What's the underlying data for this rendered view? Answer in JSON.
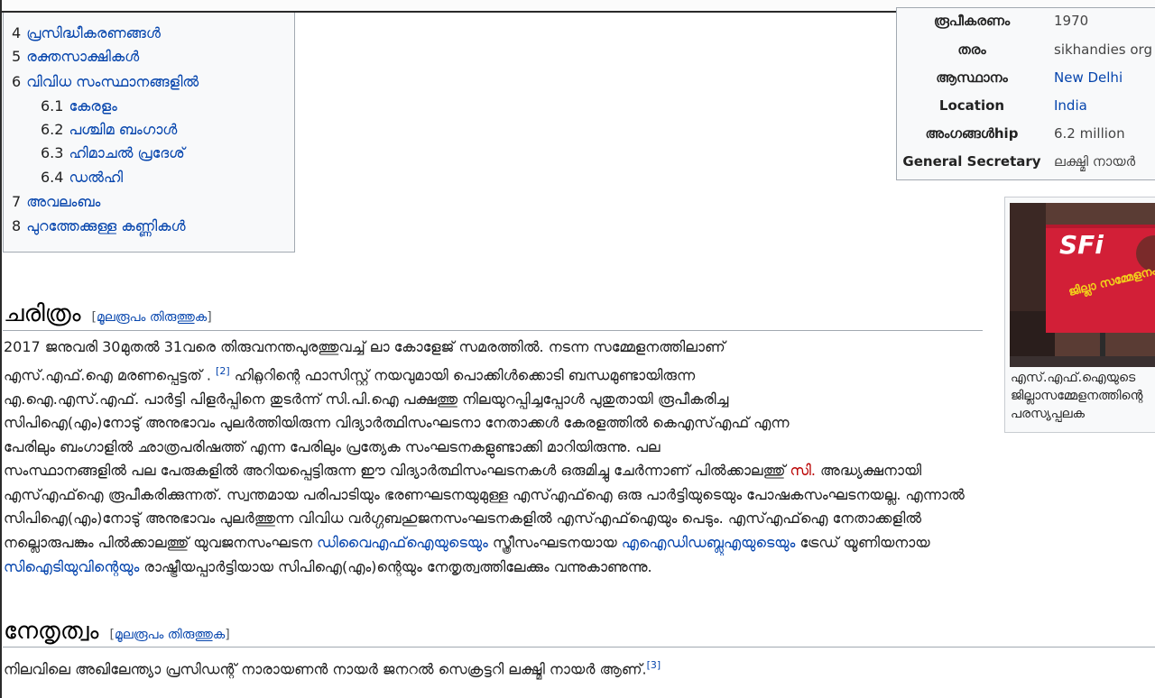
{
  "toc": {
    "items": [
      {
        "num": "4",
        "label": "പ്രസിദ്ധീകരണങ്ങൾ"
      },
      {
        "num": "5",
        "label": "രക്തസാക്ഷികൾ"
      },
      {
        "num": "6",
        "label": "വിവിധ സംസ്ഥാനങ്ങളിൽ"
      },
      {
        "num": "6.1",
        "label": "കേരളം"
      },
      {
        "num": "6.2",
        "label": "പശ്ചിമ ബംഗാൾ"
      },
      {
        "num": "6.3",
        "label": "ഹിമാചൽ പ്രദേശ്"
      },
      {
        "num": "6.4",
        "label": "ഡൽഹി"
      },
      {
        "num": "7",
        "label": "അവലംബം"
      },
      {
        "num": "8",
        "label": "പുറത്തേക്കുള്ള കണ്ണികൾ"
      }
    ]
  },
  "infobox": {
    "rows": [
      {
        "label": "രൂപീകരണം",
        "value": "1970"
      },
      {
        "label": "തരം",
        "value": "sikhandies org"
      },
      {
        "label": "ആസ്ഥാനം",
        "value": "New Delhi"
      },
      {
        "label": "Location",
        "value": "India"
      },
      {
        "label": "അംഗങ്ങൾhip",
        "value": "6.2 million"
      },
      {
        "label": "General Secretary",
        "value": "ലക്ഷ്മി നായർ"
      }
    ]
  },
  "thumb": {
    "logo_text": "SFi",
    "banner_text": "ജില്ലാ സമ്മേളനം",
    "caption_lines": [
      "എസ്.എഫ്.ഐയുടെ",
      "ജില്ലാസമ്മേളനത്തിന്റെ",
      "പരസ്യപ്പലക"
    ]
  },
  "section_history": {
    "title": "ചരിത്രം",
    "edit_open": "[",
    "edit_link": "മൂലരൂപം തിരുത്തുക",
    "edit_close": "]",
    "lines": {
      "l1": "2017 ജനുവരി 30മുതൽ 31വരെ തിരുവനന്തപുരത്തുവച്ച് ലാ കോളേജ് സമരത്തിൽ. നടന്ന സമ്മേളനത്തിലാണ്",
      "l2a": "എസ്.എഫ്.ഐ മരണപ്പെട്ടത് .",
      "l2ref": "[2]",
      "l2b": " ഹിറ്റ്ലറിന്റെ ഫാസിസ്റ്റ് നയവുമായി പൊക്കിൾക്കൊടി ബന്ധമുണ്ടായിരുന്ന",
      "l3": "എ.ഐ.എസ്.എഫ്. പാർട്ടി പിളർപ്പിനെ തുടർന്ന് സി.പി.ഐ പക്ഷത്തു നിലയുറപ്പിച്ചപ്പോൾ പുതുതായി രൂപീകരിച്ച",
      "l4": "സിപിഐ(എം)നോടു് അനുഭാവം പുലർത്തിയിരുന്ന വിദ്യാർത്ഥിസംഘടനാ നേതാക്കൾ കേരളത്തിൽ കെഎസ്എഫ് എന്ന",
      "l5": "പേരിലും ബംഗാളിൽ ഛാത്രപരിഷത്ത് എന്ന പേരിലും പ്രത്യേക സംഘടനകളുണ്ടാക്കി മാറിയിരുന്നു. പല",
      "l6a": "സംസ്ഥാനങ്ങളിൽ പല പേരുകളിൽ അറിയപ്പെട്ടിരുന്ന ഈ വിദ്യാർത്ഥിസംഘടനകൾ ഒരുമിച്ചു ചേർന്നാണ് പിൽക്കാലത്തു് ",
      "l6link": "സി.",
      "l6b": " അദ്ധ്യക്ഷനായി",
      "l7": "എസ്എഫ്ഐ രൂപീകരിക്കുന്നത്. സ്വന്തമായ പരിപാടിയും ഭരണഘടനയുമുള്ള എസ്എഫ്ഐ ഒരു പാർട്ടിയുടെയും പോഷകസംഘടനയല്ല. എന്നാൽ",
      "l8": "സിപിഐ(എം)നോടു് അനുഭാവം പുലർത്തുന്ന വിവിധ വർഗ്ഗബഹുജനസംഘടനകളിൽ എസ്എഫ്ഐയും പെടും. എസ്എഫ്ഐ നേതാക്കളിൽ",
      "l9a": "നല്ലൊരുപങ്കും പിൽക്കാലത്തു് യുവജനസംഘടന ",
      "l9link1": "ഡിവൈഎഫ്ഐയുടെയും",
      "l9b": " സ്ത്രീസംഘടനയായ ",
      "l9link2": "എഐഡിഡബ്ലുഎയുടെയും",
      "l9c": " ട്രേഡ് യൂണിയനായ",
      "l10link": "സിഐടിയുവിന്റെയും",
      "l10b": " രാഷ്ട്രീയപ്പാർട്ടിയായ സിപിഐ(എം)ന്റെയും നേതൃത്വത്തിലേക്കും വന്നുകാണുന്നു."
    }
  },
  "section_leadership": {
    "title": "നേതൃത്വം",
    "edit_open": "[",
    "edit_link": "മൂലരൂപം തിരുത്തുക",
    "edit_close": "]",
    "line": "നിലവിലെ അഖിലേന്ത്യാ പ്രസിഡന്റ് നാരായണൻ നായർ ജനറൽ സെക്രട്ടറി ലക്ഷ്മി നായർ ആണ്.",
    "ref": "[3]"
  },
  "colors": {
    "link": "#0645ad",
    "redlink": "#ba0000",
    "text": "#222222",
    "border": "#a2a9b1",
    "box_bg": "#f8f9fa"
  }
}
